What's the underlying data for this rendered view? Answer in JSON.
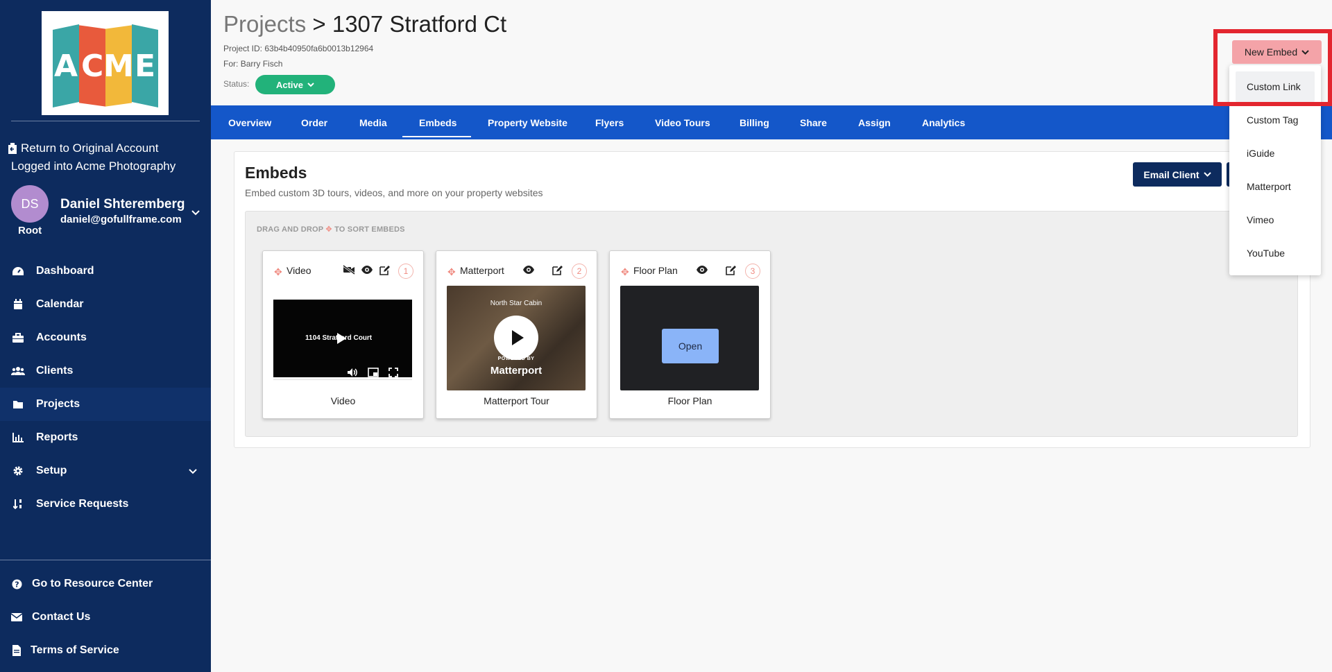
{
  "sidebar": {
    "logo_letters": [
      "A",
      "C",
      "M",
      "E"
    ],
    "return_link": "Return to Original Account",
    "logged_into": "Logged into Acme Photography",
    "user": {
      "initials": "DS",
      "name": "Daniel Shteremberg",
      "email": "daniel@gofullframe.com",
      "role": "Root"
    },
    "nav": [
      {
        "label": "Dashboard",
        "icon": "dashboard-icon"
      },
      {
        "label": "Calendar",
        "icon": "calendar-icon"
      },
      {
        "label": "Accounts",
        "icon": "briefcase-icon"
      },
      {
        "label": "Clients",
        "icon": "users-icon"
      },
      {
        "label": "Projects",
        "icon": "folder-icon"
      },
      {
        "label": "Reports",
        "icon": "chart-icon"
      },
      {
        "label": "Setup",
        "icon": "gear-icon"
      },
      {
        "label": "Service Requests",
        "icon": "sort-icon"
      }
    ],
    "footer": [
      {
        "label": "Go to Resource Center",
        "icon": "question-icon"
      },
      {
        "label": "Contact Us",
        "icon": "envelope-icon"
      },
      {
        "label": "Terms of Service",
        "icon": "document-icon"
      }
    ]
  },
  "header": {
    "crumb_parent": "Projects",
    "crumb_sep": ">",
    "crumb_current": "1307 Stratford Ct",
    "project_id_label": "Project ID:",
    "project_id": "63b4b40950fa6b0013b12964",
    "for_label": "For:",
    "for_value": "Barry Fisch",
    "status_label": "Status:",
    "status": "Active"
  },
  "tabs": [
    "Overview",
    "Order",
    "Media",
    "Embeds",
    "Property Website",
    "Flyers",
    "Video Tours",
    "Billing",
    "Share",
    "Assign",
    "Analytics"
  ],
  "active_tab": "Embeds",
  "embeds_section": {
    "title": "Embeds",
    "subtitle": "Embed custom 3D tours, videos, and more on your property websites",
    "email_client": "Email Client",
    "sort_hint_before": "DRAG AND DROP",
    "sort_hint_after": "TO SORT EMBEDS",
    "cards": [
      {
        "title": "Video",
        "number": "1",
        "caption": "Video",
        "thumb_text": "1104 Stratford Court"
      },
      {
        "title": "Matterport",
        "number": "2",
        "caption": "Matterport Tour",
        "thumb_heading": "North Star Cabin",
        "powered_by": "POWERED BY",
        "brand": "Matterport"
      },
      {
        "title": "Floor Plan",
        "number": "3",
        "caption": "Floor Plan",
        "open_label": "Open"
      }
    ]
  },
  "new_embed": {
    "button": "New Embed",
    "options": [
      "Custom Link",
      "Custom Tag",
      "iGuide",
      "Matterport",
      "Vimeo",
      "YouTube"
    ],
    "hovered_option": "Custom Link"
  },
  "colors": {
    "sidebar": "#0d2b5e",
    "tabbar": "#1457c9",
    "status_active": "#22b27a",
    "new_embed": "#f4a3a8",
    "highlight": "#e3262f"
  }
}
